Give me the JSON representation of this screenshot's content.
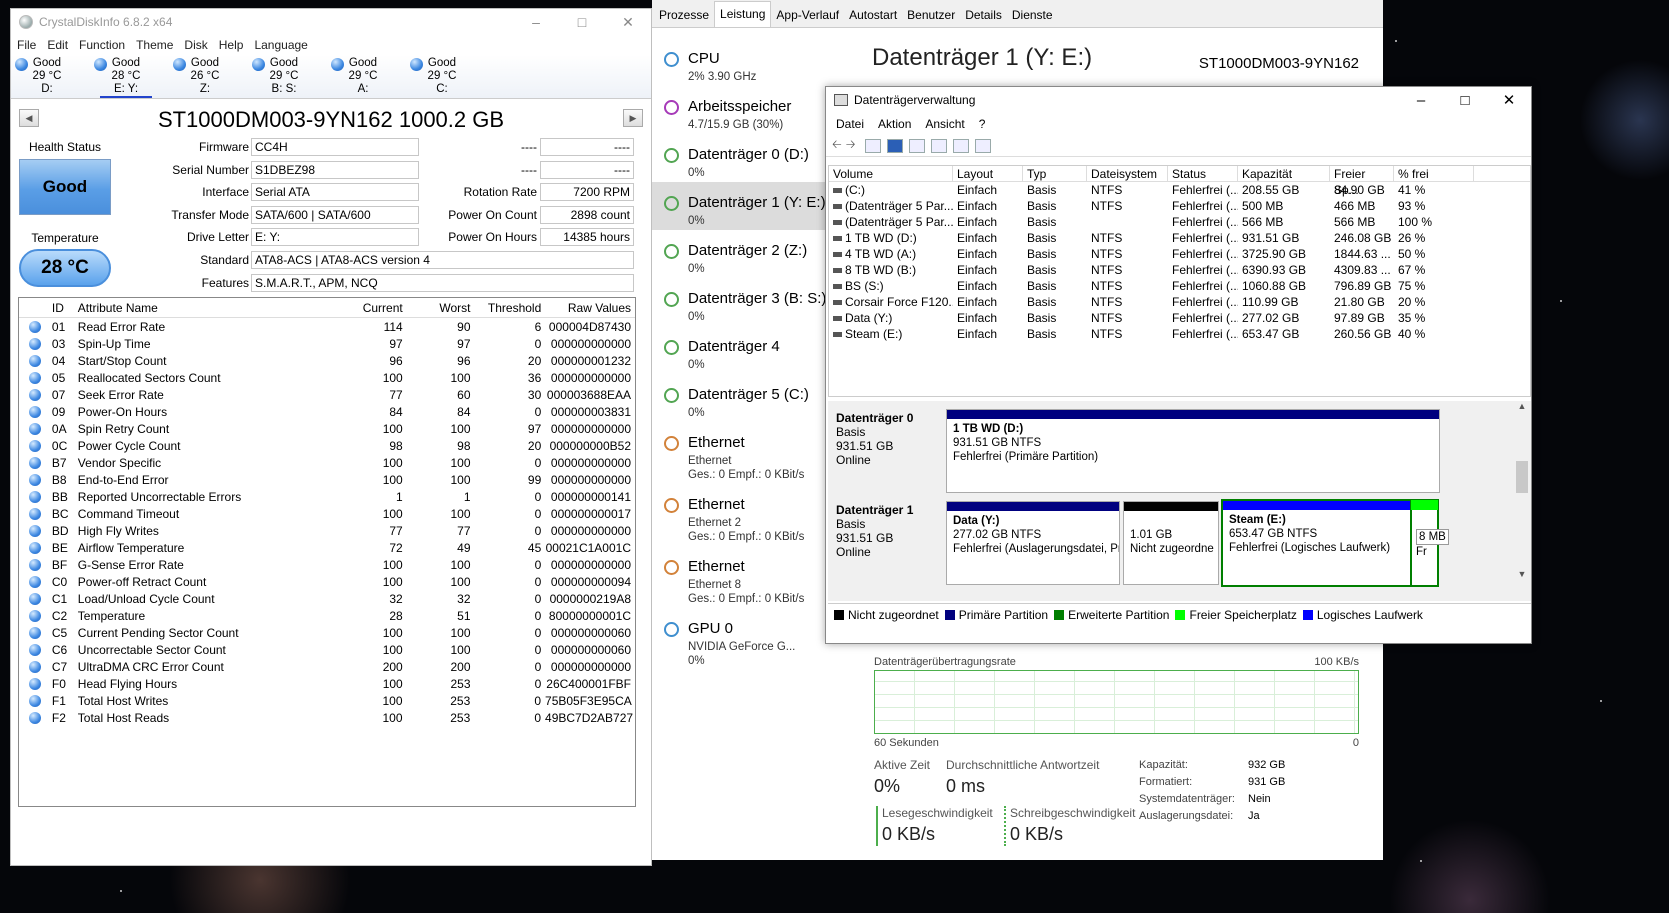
{
  "cdi": {
    "title": "CrystalDiskInfo 6.8.2 x64",
    "menu": [
      "File",
      "Edit",
      "Function",
      "Theme",
      "Disk",
      "Help",
      "Language"
    ],
    "drives": [
      {
        "status": "Good",
        "temp": "29 °C",
        "letter": "D:"
      },
      {
        "status": "Good",
        "temp": "28 °C",
        "letter": "E: Y:"
      },
      {
        "status": "Good",
        "temp": "26 °C",
        "letter": "Z:"
      },
      {
        "status": "Good",
        "temp": "29 °C",
        "letter": "B: S:"
      },
      {
        "status": "Good",
        "temp": "29 °C",
        "letter": "A:"
      },
      {
        "status": "Good",
        "temp": "29 °C",
        "letter": "C:"
      }
    ],
    "model": "ST1000DM003-9YN162 1000.2 GB",
    "health_label": "Health Status",
    "health": "Good",
    "temp_label": "Temperature",
    "temp": "28 °C",
    "firmware_label": "Firmware",
    "firmware": "CC4H",
    "serial_label": "Serial Number",
    "serial": "S1DBEZ98",
    "interface_label": "Interface",
    "interface": "Serial ATA",
    "transfer_label": "Transfer Mode",
    "transfer": "SATA/600 | SATA/600",
    "letter_label": "Drive Letter",
    "letter": "E: Y:",
    "standard_label": "Standard",
    "standard": "ATA8-ACS | ATA8-ACS version 4",
    "features_label": "Features",
    "features": "S.M.A.R.T., APM, NCQ",
    "dash1a": "----",
    "dash1b": "----",
    "dash2a": "----",
    "dash2b": "----",
    "rot_label": "Rotation Rate",
    "rot": "7200 RPM",
    "poc_label": "Power On Count",
    "poc": "2898 count",
    "poh_label": "Power On Hours",
    "poh": "14385 hours",
    "smart_headers": [
      "ID",
      "Attribute Name",
      "Current",
      "Worst",
      "Threshold",
      "Raw Values"
    ],
    "smart": [
      [
        "01",
        "Read Error Rate",
        "114",
        "90",
        "6",
        "000004D87430"
      ],
      [
        "03",
        "Spin-Up Time",
        "97",
        "97",
        "0",
        "000000000000"
      ],
      [
        "04",
        "Start/Stop Count",
        "96",
        "96",
        "20",
        "000000001232"
      ],
      [
        "05",
        "Reallocated Sectors Count",
        "100",
        "100",
        "36",
        "000000000000"
      ],
      [
        "07",
        "Seek Error Rate",
        "77",
        "60",
        "30",
        "000003688EAA"
      ],
      [
        "09",
        "Power-On Hours",
        "84",
        "84",
        "0",
        "000000003831"
      ],
      [
        "0A",
        "Spin Retry Count",
        "100",
        "100",
        "97",
        "000000000000"
      ],
      [
        "0C",
        "Power Cycle Count",
        "98",
        "98",
        "20",
        "000000000B52"
      ],
      [
        "B7",
        "Vendor Specific",
        "100",
        "100",
        "0",
        "000000000000"
      ],
      [
        "B8",
        "End-to-End Error",
        "100",
        "100",
        "99",
        "000000000000"
      ],
      [
        "BB",
        "Reported Uncorrectable Errors",
        "1",
        "1",
        "0",
        "000000000141"
      ],
      [
        "BC",
        "Command Timeout",
        "100",
        "100",
        "0",
        "000000000017"
      ],
      [
        "BD",
        "High Fly Writes",
        "77",
        "77",
        "0",
        "000000000000"
      ],
      [
        "BE",
        "Airflow Temperature",
        "72",
        "49",
        "45",
        "00021C1A001C"
      ],
      [
        "BF",
        "G-Sense Error Rate",
        "100",
        "100",
        "0",
        "000000000000"
      ],
      [
        "C0",
        "Power-off Retract Count",
        "100",
        "100",
        "0",
        "000000000094"
      ],
      [
        "C1",
        "Load/Unload Cycle Count",
        "32",
        "32",
        "0",
        "0000000219A8"
      ],
      [
        "C2",
        "Temperature",
        "28",
        "51",
        "0",
        "80000000001C"
      ],
      [
        "C5",
        "Current Pending Sector Count",
        "100",
        "100",
        "0",
        "000000000060"
      ],
      [
        "C6",
        "Uncorrectable Sector Count",
        "100",
        "100",
        "0",
        "000000000060"
      ],
      [
        "C7",
        "UltraDMA CRC Error Count",
        "200",
        "200",
        "0",
        "000000000000"
      ],
      [
        "F0",
        "Head Flying Hours",
        "100",
        "253",
        "0",
        "26C400001FBF"
      ],
      [
        "F1",
        "Total Host Writes",
        "100",
        "253",
        "0",
        "75B05F3E95CA"
      ],
      [
        "F2",
        "Total Host Reads",
        "100",
        "253",
        "0",
        "49BC7D2AB727"
      ]
    ]
  },
  "tm": {
    "tabs": [
      "Prozesse",
      "Leistung",
      "App-Verlauf",
      "Autostart",
      "Benutzer",
      "Details",
      "Dienste"
    ],
    "items": [
      {
        "name": "CPU",
        "sub": "2% 3.90 GHz",
        "sub2": "",
        "color": "#3f8fcf"
      },
      {
        "name": "Arbeitsspeicher",
        "sub": "4.7/15.9 GB (30%)",
        "sub2": "",
        "color": "#a63ab8"
      },
      {
        "name": "Datenträger 0 (D:)",
        "sub": "0%",
        "sub2": "",
        "color": "#52a552"
      },
      {
        "name": "Datenträger 1 (Y: E:)",
        "sub": "0%",
        "sub2": "",
        "color": "#52a552"
      },
      {
        "name": "Datenträger 2 (Z:)",
        "sub": "0%",
        "sub2": "",
        "color": "#52a552"
      },
      {
        "name": "Datenträger 3 (B: S:)",
        "sub": "0%",
        "sub2": "",
        "color": "#52a552"
      },
      {
        "name": "Datenträger 4",
        "sub": "0%",
        "sub2": "",
        "color": "#52a552"
      },
      {
        "name": "Datenträger 5 (C:)",
        "sub": "0%",
        "sub2": "",
        "color": "#52a552"
      },
      {
        "name": "Ethernet",
        "sub": "Ethernet",
        "sub2": "Ges.: 0 Empf.: 0 KBit/s",
        "color": "#d2823a"
      },
      {
        "name": "Ethernet",
        "sub": "Ethernet 2",
        "sub2": "Ges.: 0 Empf.: 0 KBit/s",
        "color": "#d2823a"
      },
      {
        "name": "Ethernet",
        "sub": "Ethernet 8",
        "sub2": "Ges.: 0 Empf.: 0 KBit/s",
        "color": "#d2823a"
      },
      {
        "name": "GPU 0",
        "sub": "NVIDIA GeForce G...",
        "sub2": "0%",
        "color": "#3f8fcf"
      }
    ],
    "title": "Datenträger 1 (Y: E:)",
    "model": "ST1000DM003-9YN162",
    "rate_label": "Datenträgerübertragungsrate",
    "rate_max": "100 KB/s",
    "sec": "60 Sekunden",
    "zero": "0",
    "active_k": "Aktive Zeit",
    "active_v": "0%",
    "resp_k": "Durchschnittliche Antwortzeit",
    "resp_v": "0 ms",
    "read_k": "Lesegeschwindigkeit",
    "read_v": "0 KB/s",
    "write_k": "Schreibgeschwindigkeit",
    "write_v": "0 KB/s",
    "kap_k": "Kapazität:",
    "kap_v": "932 GB",
    "fmt_k": "Formatiert:",
    "fmt_v": "931 GB",
    "sys_k": "Systemdatenträger:",
    "sys_v": "Nein",
    "swap_k": "Auslagerungsdatei:",
    "swap_v": "Ja"
  },
  "dm": {
    "title": "Datenträgerverwaltung",
    "menu": [
      "Datei",
      "Aktion",
      "Ansicht",
      "?"
    ],
    "headers": [
      "Volume",
      "Layout",
      "Typ",
      "Dateisystem",
      "Status",
      "Kapazität",
      "Freier Sp...",
      "% frei"
    ],
    "rows": [
      [
        "(C:)",
        "Einfach",
        "Basis",
        "NTFS",
        "Fehlerfrei (...",
        "208.55 GB",
        "84.90 GB",
        "41 %"
      ],
      [
        "(Datenträger 5 Par...",
        "Einfach",
        "Basis",
        "NTFS",
        "Fehlerfrei (...",
        "500 MB",
        "466 MB",
        "93 %"
      ],
      [
        "(Datenträger 5 Par...",
        "Einfach",
        "Basis",
        "",
        "Fehlerfrei (...",
        "566 MB",
        "566 MB",
        "100 %"
      ],
      [
        "1 TB WD (D:)",
        "Einfach",
        "Basis",
        "NTFS",
        "Fehlerfrei (...",
        "931.51 GB",
        "246.08 GB",
        "26 %"
      ],
      [
        "4 TB WD (A:)",
        "Einfach",
        "Basis",
        "NTFS",
        "Fehlerfrei (...",
        "3725.90 GB",
        "1844.63 ...",
        "50 %"
      ],
      [
        "8 TB WD (B:)",
        "Einfach",
        "Basis",
        "NTFS",
        "Fehlerfrei (...",
        "6390.93 GB",
        "4309.83 ...",
        "67 %"
      ],
      [
        "BS (S:)",
        "Einfach",
        "Basis",
        "NTFS",
        "Fehlerfrei (...",
        "1060.88 GB",
        "796.89 GB",
        "75 %"
      ],
      [
        "Corsair Force F120...",
        "Einfach",
        "Basis",
        "NTFS",
        "Fehlerfrei (...",
        "110.99 GB",
        "21.80 GB",
        "20 %"
      ],
      [
        "Data (Y:)",
        "Einfach",
        "Basis",
        "NTFS",
        "Fehlerfrei (...",
        "277.02 GB",
        "97.89 GB",
        "35 %"
      ],
      [
        "Steam (E:)",
        "Einfach",
        "Basis",
        "NTFS",
        "Fehlerfrei (...",
        "653.47 GB",
        "260.56 GB",
        "40 %"
      ]
    ],
    "disk0": {
      "name": "Datenträger 0",
      "type": "Basis",
      "size": "931.51 GB",
      "state": "Online",
      "p_name": "1 TB WD  (D:)",
      "p_size": "931.51 GB NTFS",
      "p_state": "Fehlerfrei (Primäre Partition)"
    },
    "disk1": {
      "name": "Datenträger 1",
      "type": "Basis",
      "size": "931.51 GB",
      "state": "Online",
      "p1_name": "Data  (Y:)",
      "p1_size": "277.02 GB NTFS",
      "p1_state": "Fehlerfrei (Auslagerungsdatei, Pr",
      "p2_size": "1.01 GB",
      "p2_state": "Nicht zugeordne",
      "p3_name": "Steam  (E:)",
      "p3_size": "653.47 GB NTFS",
      "p3_state": "Fehlerfrei (Logisches Laufwerk)",
      "p4_size": "8 MB",
      "p4_state": "Fr"
    },
    "legend": [
      {
        "label": "Nicht zugeordnet",
        "color": "#000000"
      },
      {
        "label": "Primäre Partition",
        "color": "#00007f"
      },
      {
        "label": "Erweiterte Partition",
        "color": "#007f00"
      },
      {
        "label": "Freier Speicherplatz",
        "color": "#00ff00"
      },
      {
        "label": "Logisches Laufwerk",
        "color": "#0000ff"
      }
    ]
  }
}
